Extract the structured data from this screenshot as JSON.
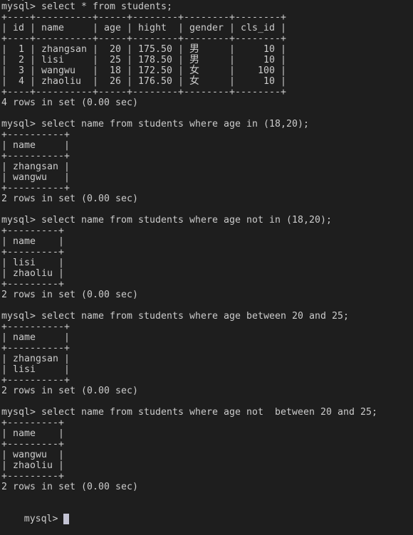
{
  "terminal": {
    "prompt": "mysql> ",
    "partial_top_line": "mysql> ",
    "theme": {
      "background": "#1e1e1e",
      "foreground": "#cccccc",
      "cursor": "#c4c4d4"
    },
    "blocks": [
      {
        "command": "select * from students;",
        "columns": [
          {
            "name": "id",
            "align": "right"
          },
          {
            "name": "name",
            "align": "left"
          },
          {
            "name": "age",
            "align": "right"
          },
          {
            "name": "hight",
            "align": "right"
          },
          {
            "name": "gender",
            "align": "left"
          },
          {
            "name": "cls_id",
            "align": "right"
          }
        ],
        "rows": [
          [
            "1",
            "zhangsan",
            "20",
            "175.50",
            "男",
            "10"
          ],
          [
            "2",
            "lisi",
            "25",
            "178.50",
            "男",
            "10"
          ],
          [
            "3",
            "wangwu",
            "18",
            "172.50",
            "女",
            "100"
          ],
          [
            "4",
            "zhaoliu",
            "26",
            "176.50",
            "女",
            "10"
          ]
        ],
        "status": "4 rows in set (0.00 sec)"
      },
      {
        "command": "select name from students where age in (18,20);",
        "columns": [
          {
            "name": "name",
            "align": "left"
          }
        ],
        "rows": [
          [
            "zhangsan"
          ],
          [
            "wangwu"
          ]
        ],
        "status": "2 rows in set (0.00 sec)"
      },
      {
        "command": "select name from students where age not in (18,20);",
        "columns": [
          {
            "name": "name",
            "align": "left"
          }
        ],
        "rows": [
          [
            "lisi"
          ],
          [
            "zhaoliu"
          ]
        ],
        "status": "2 rows in set (0.00 sec)"
      },
      {
        "command": "select name from students where age between 20 and 25;",
        "columns": [
          {
            "name": "name",
            "align": "left"
          }
        ],
        "rows": [
          [
            "zhangsan"
          ],
          [
            "lisi"
          ]
        ],
        "status": "2 rows in set (0.00 sec)"
      },
      {
        "command": "select name from students where age not  between 20 and 25;",
        "columns": [
          {
            "name": "name",
            "align": "left"
          }
        ],
        "rows": [
          [
            "wangwu"
          ],
          [
            "zhaoliu"
          ]
        ],
        "status": "2 rows in set (0.00 sec)"
      }
    ],
    "current_input": ""
  }
}
